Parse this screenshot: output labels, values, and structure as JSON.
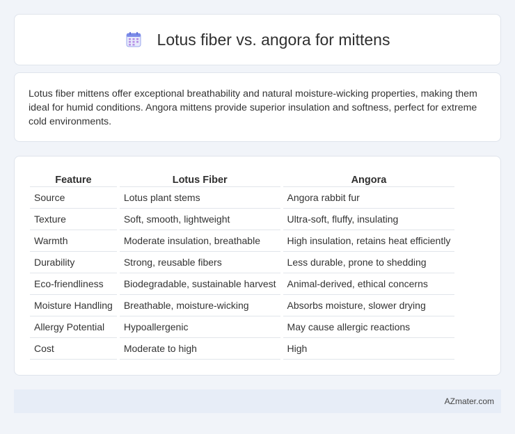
{
  "header": {
    "title": "Lotus fiber vs. angora for mittens",
    "icon": "calendar-icon"
  },
  "intro": {
    "text": "Lotus fiber mittens offer exceptional breathability and natural moisture-wicking properties, making them ideal for humid conditions. Angora mittens provide superior insulation and softness, perfect for extreme cold environments."
  },
  "table": {
    "headers": [
      "Feature",
      "Lotus Fiber",
      "Angora"
    ],
    "rows": [
      [
        "Source",
        "Lotus plant stems",
        "Angora rabbit fur"
      ],
      [
        "Texture",
        "Soft, smooth, lightweight",
        "Ultra-soft, fluffy, insulating"
      ],
      [
        "Warmth",
        "Moderate insulation, breathable",
        "High insulation, retains heat efficiently"
      ],
      [
        "Durability",
        "Strong, reusable fibers",
        "Less durable, prone to shedding"
      ],
      [
        "Eco-friendliness",
        "Biodegradable, sustainable harvest",
        "Animal-derived, ethical concerns"
      ],
      [
        "Moisture Handling",
        "Breathable, moisture-wicking",
        "Absorbs moisture, slower drying"
      ],
      [
        "Allergy Potential",
        "Hypoallergenic",
        "May cause allergic reactions"
      ],
      [
        "Cost",
        "Moderate to high",
        "High"
      ]
    ]
  },
  "footer": {
    "brand": "AZmater.com"
  },
  "colors": {
    "background": "#f1f4f9",
    "card": "#ffffff",
    "footer": "#e7edf7",
    "icon_accent": "#7b8be8"
  }
}
